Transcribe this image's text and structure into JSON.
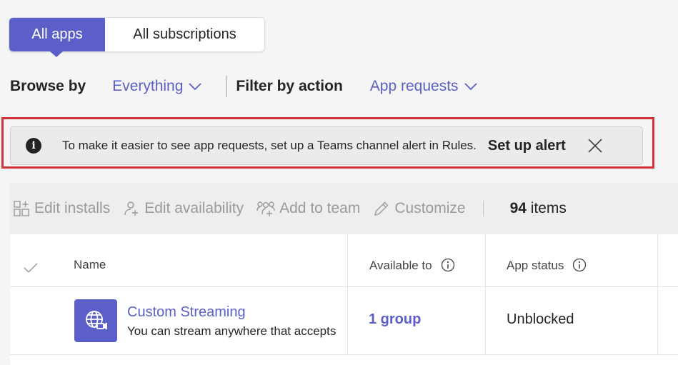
{
  "tabs": [
    {
      "label": "All apps",
      "active": true
    },
    {
      "label": "All subscriptions",
      "active": false
    }
  ],
  "filters": {
    "browse_label": "Browse by",
    "browse_value": "Everything",
    "action_label": "Filter by action",
    "action_value": "App requests"
  },
  "banner": {
    "message": "To make it easier to see app requests, set up a Teams channel alert in Rules.",
    "action_label": "Set up alert"
  },
  "toolbar": {
    "edit_installs": "Edit installs",
    "edit_availability": "Edit availability",
    "add_to_team": "Add to team",
    "customize": "Customize",
    "item_count": "94",
    "item_suffix": " items"
  },
  "table": {
    "headers": {
      "name": "Name",
      "available_to": "Available to",
      "app_status": "App status"
    },
    "rows": [
      {
        "name": "Custom Streaming",
        "description": "You can stream anywhere that accepts",
        "available_to": "1 group",
        "status": "Unblocked"
      }
    ]
  },
  "colors": {
    "accent": "#5b5fc7",
    "highlight_border": "#d13438"
  },
  "icons": [
    "info-icon",
    "close-icon",
    "chevron-down-icon",
    "grid-add-icon",
    "person-add-icon",
    "people-add-icon",
    "pencil-icon",
    "checkmark-icon",
    "globe-video-icon"
  ]
}
